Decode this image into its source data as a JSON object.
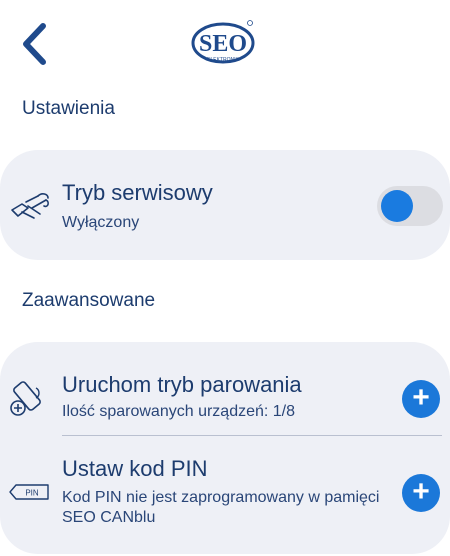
{
  "header": {
    "logo_text": "SEO",
    "logo_sub": "ELEKTRONIK",
    "back_icon": "chevron-left-icon"
  },
  "settings": {
    "section_title": "Ustawienia",
    "service_mode": {
      "icon": "wrench-screwdriver-icon",
      "title": "Tryb serwisowy",
      "status": "Wyłączony",
      "toggle_on": false
    }
  },
  "advanced": {
    "section_title": "Zaawansowane",
    "pairing": {
      "icon": "pairing-device-icon",
      "title": "Uruchom tryb parowania",
      "subtitle": "Ilość sparowanych urządzeń: 1/8",
      "action": "+"
    },
    "pin": {
      "icon": "pin-tag-icon",
      "icon_label": "PIN",
      "title": "Ustaw kod PIN",
      "subtitle": "Kod PIN nie jest zaprogramowany w pamięci SEO CANblu",
      "action": "+"
    }
  },
  "colors": {
    "accent": "#1b78d9",
    "text": "#1d3c6e",
    "card_bg": "#eef0f6"
  }
}
